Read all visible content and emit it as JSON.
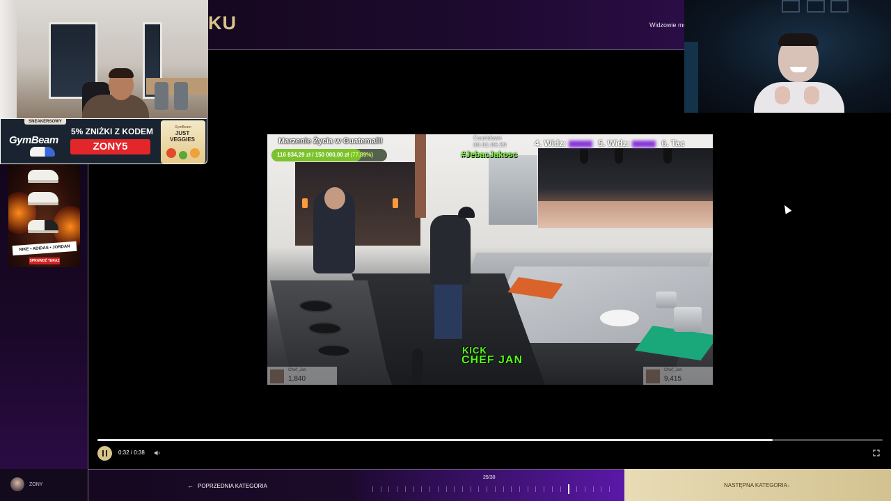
{
  "header": {
    "title_fragment": "KU",
    "viewers_note": "Widzowie mog"
  },
  "sponsor": {
    "tag": "SNEAKERSOWY",
    "brand": "GymBeam",
    "promo": "5% ZNIŻKI Z KODEM",
    "code": "ZONY5",
    "product_brand": "GymBeam",
    "product_name": "JUST VEGGIES"
  },
  "sneaker_ad": {
    "brands": "NIKE • ADIDAS • JORDAN",
    "cta": "SPRAWDŹ TERAZ"
  },
  "stream_overlay": {
    "goal_title": "Marzenie Życia w Guatemali!",
    "goal_current": "116 834,29 zł",
    "goal_target": "150 000,00 zł",
    "goal_percent_label": "(77.89%)",
    "goal_fraction": 0.7789,
    "countdown_label": "Countdown",
    "countdown_time": "00:01:06:39",
    "hashtag": "#JebacJakosc",
    "ranking": [
      {
        "label": "4. Widz:"
      },
      {
        "label": "5. Widz:"
      },
      {
        "label": "6. Tac"
      }
    ],
    "platform": "KICK",
    "channel_brand": "CHEF JAN",
    "follow_cards": [
      {
        "name": "Chef_Jan",
        "count": "1,840"
      },
      {
        "name": "Chef_Jan",
        "count": "9,415"
      }
    ]
  },
  "player": {
    "time": "0:32 / 0:38",
    "progress_fraction": 0.86,
    "play_state": "playing",
    "icons": {
      "pause": "pause-icon",
      "volume": "volume-icon",
      "fullscreen": "fullscreen-icon"
    }
  },
  "bottom_bar": {
    "username": "ZONY",
    "prev_label": "POPRZEDNIA KATEGORIA",
    "counter": "25/30",
    "current_index": 25,
    "total": 30,
    "next_label": "NASTĘPNA KATEGORIA"
  },
  "colors": {
    "accent_gold": "#d9c48a",
    "purple": "#5a18a8",
    "kick_green": "#53fc18",
    "promo_red": "#e3262a"
  }
}
